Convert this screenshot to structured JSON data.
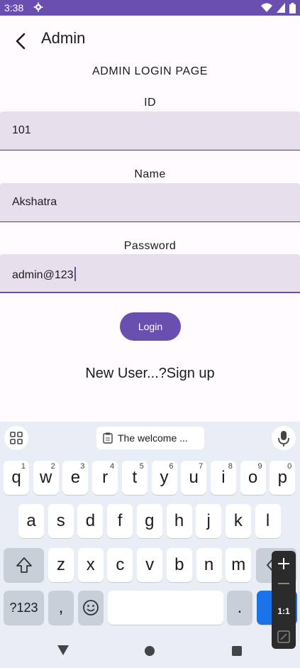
{
  "status_bar": {
    "time": "3:38"
  },
  "app_bar": {
    "title": "Admin"
  },
  "page": {
    "heading": "ADMIN LOGIN PAGE"
  },
  "form": {
    "id_label": "ID",
    "id_value": "101",
    "name_label": "Name",
    "name_value": "Akshatra",
    "password_label": "Password",
    "password_value": "admin@123",
    "login_label": "Login",
    "signup_text": "New User...?Sign up"
  },
  "keyboard": {
    "clipboard_suggestion": "The welcome ...",
    "row1": [
      {
        "k": "q",
        "s": "1"
      },
      {
        "k": "w",
        "s": "2"
      },
      {
        "k": "e",
        "s": "3"
      },
      {
        "k": "r",
        "s": "4"
      },
      {
        "k": "t",
        "s": "5"
      },
      {
        "k": "y",
        "s": "6"
      },
      {
        "k": "u",
        "s": "7"
      },
      {
        "k": "i",
        "s": "8"
      },
      {
        "k": "o",
        "s": "9"
      },
      {
        "k": "p",
        "s": "0"
      }
    ],
    "row2": [
      "a",
      "s",
      "d",
      "f",
      "g",
      "h",
      "j",
      "k",
      "l"
    ],
    "row3": [
      "z",
      "x",
      "c",
      "v",
      "b",
      "n",
      "m"
    ],
    "symbols_label": "?123",
    "comma": ",",
    "period": "."
  },
  "float_panel": {
    "zoom": "1:1"
  },
  "colors": {
    "accent": "#6b4fb0",
    "field_bg": "#e7e0ec",
    "keyboard_bg": "#e9eef6"
  }
}
